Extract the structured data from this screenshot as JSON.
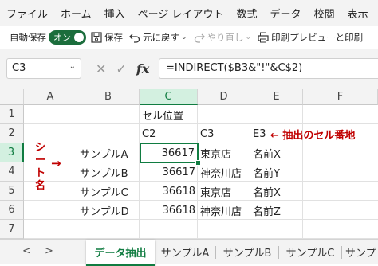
{
  "menu": [
    "ファイル",
    "ホーム",
    "挿入",
    "ページ レイアウト",
    "数式",
    "データ",
    "校閲",
    "表示",
    "ヘ"
  ],
  "qat": {
    "autosave_label": "自動保存",
    "toggle_label": "オン",
    "save_label": "保存",
    "undo_label": "元に戻す",
    "redo_label": "やり直し",
    "print_preview_label": "印刷プレビューと印刷"
  },
  "formula_bar": {
    "name_box": "C3",
    "formula": "=INDIRECT($B3&\"!\"&C$2)"
  },
  "columns": [
    "A",
    "B",
    "C",
    "D",
    "E",
    "F"
  ],
  "rows": [
    "1",
    "2",
    "3",
    "4",
    "5",
    "6",
    "7"
  ],
  "cells": {
    "C1": "セル位置",
    "C2": "C2",
    "D2": "C3",
    "E2": "E3",
    "B3": "サンプルA",
    "C3": "36617",
    "D3": "東京店",
    "E3": "名前X",
    "B4": "サンプルB",
    "C4": "36617",
    "D4": "神奈川店",
    "E4": "名前Y",
    "B5": "サンプルC",
    "C5": "36618",
    "D5": "東京店",
    "E5": "名前X",
    "B6": "サンプルD",
    "C6": "36618",
    "D6": "神奈川店",
    "E6": "名前Z"
  },
  "annotations": {
    "cell_address": "← 抽出のセル番地",
    "sheet_name_vertical": [
      "シ",
      "ー",
      "ト",
      "名"
    ],
    "arrow": "→"
  },
  "sheet_tabs": {
    "prev": "<",
    "next": ">",
    "tabs": [
      "データ抽出",
      "サンプルA",
      "サンプルB",
      "サンプルC",
      "サンプ"
    ]
  },
  "colors": {
    "accent": "#107c41",
    "annotation": "#c00000"
  }
}
